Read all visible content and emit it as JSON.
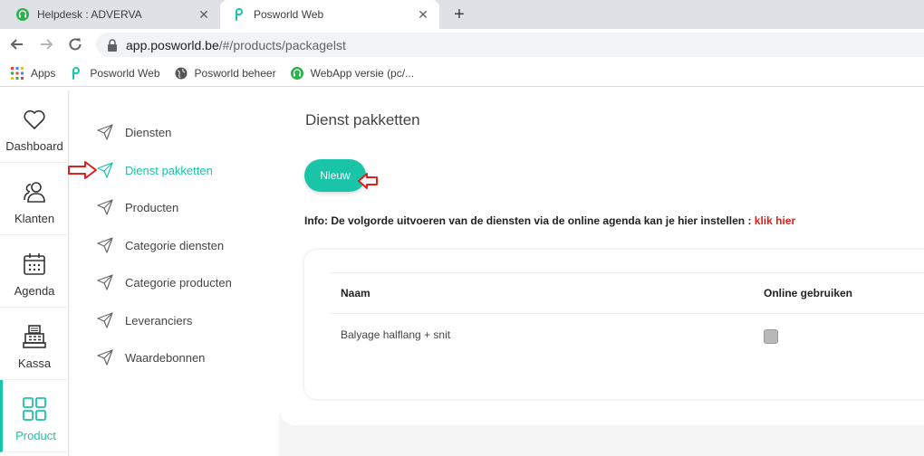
{
  "browser": {
    "tabs": [
      {
        "title": "Helpdesk : ADVERVA",
        "favicon": "headset-icon",
        "active": false
      },
      {
        "title": "Posworld Web",
        "favicon": "posworld-icon",
        "active": true
      }
    ],
    "url_host": "app.posworld.be",
    "url_path": "/#/products/packagelst",
    "bookmarks": [
      {
        "label": "Apps",
        "icon": "apps-grid-icon"
      },
      {
        "label": "Posworld Web",
        "icon": "posworld-icon"
      },
      {
        "label": "Posworld beheer",
        "icon": "globe-icon"
      },
      {
        "label": "WebApp versie (pc/...",
        "icon": "headset-icon"
      }
    ]
  },
  "sidebar": {
    "items": [
      {
        "label": "Dashboard",
        "icon": "heart-icon",
        "active": false
      },
      {
        "label": "Klanten",
        "icon": "users-icon",
        "active": false
      },
      {
        "label": "Agenda",
        "icon": "calendar-icon",
        "active": false
      },
      {
        "label": "Kassa",
        "icon": "cash-register-icon",
        "active": false
      },
      {
        "label": "Product",
        "icon": "grid-icon",
        "active": true
      }
    ]
  },
  "submenu": {
    "items": [
      {
        "label": "Diensten",
        "active": false
      },
      {
        "label": "Dienst pakketten",
        "active": true
      },
      {
        "label": "Producten",
        "active": false
      },
      {
        "label": "Categorie diensten",
        "active": false
      },
      {
        "label": "Categorie producten",
        "active": false
      },
      {
        "label": "Leveranciers",
        "active": false
      },
      {
        "label": "Waardebonnen",
        "active": false
      }
    ]
  },
  "main": {
    "title": "Dienst pakketten",
    "new_button": "Nieuw",
    "info_text": "Info: De volgorde uitvoeren van de diensten via de online agenda kan je hier instellen :",
    "info_link": "klik hier",
    "table": {
      "headers": [
        "Naam",
        "Online gebruiken"
      ],
      "rows": [
        {
          "name": "Balyage halflang + snit",
          "online": false
        }
      ]
    }
  },
  "colors": {
    "accent": "#19c4a7",
    "link": "#e0201b",
    "annotation_arrow": "#e0201b"
  }
}
